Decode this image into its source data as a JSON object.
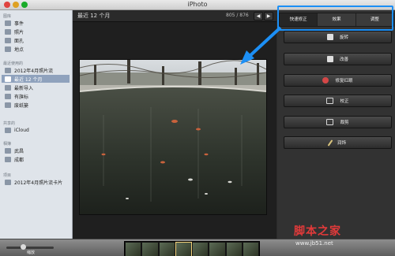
{
  "window": {
    "title": "iPhoto"
  },
  "sidebar": {
    "sections": [
      {
        "title": "图库",
        "items": [
          "事件",
          "照片",
          "面孔",
          "地点"
        ]
      },
      {
        "title": "最近使用的",
        "items": [
          "2012年4月照片流",
          "最近 12 个月",
          "最新导入",
          "有旗标",
          "废纸篓"
        ]
      },
      {
        "title": "共享的",
        "items": [
          "iCloud"
        ]
      },
      {
        "title": "相簿",
        "items": [
          "武昌",
          "成都"
        ]
      },
      {
        "title": "项目",
        "items": [
          "2012年4月照片流卡片"
        ]
      }
    ]
  },
  "viewer": {
    "event_title": "最近 12 个月",
    "counter": "805 / 876",
    "nav": {
      "prev": "◀",
      "next": "▶"
    }
  },
  "panel": {
    "tabs": [
      "快速修正",
      "效果",
      "调整"
    ],
    "tools": [
      "旋转",
      "改善",
      "修复红眼",
      "校正",
      "裁剪",
      "润饰"
    ]
  },
  "bottombar": {
    "zoom_label": "缩放"
  },
  "watermark": {
    "text": "脚本之家",
    "url": "www.jb51.net"
  }
}
